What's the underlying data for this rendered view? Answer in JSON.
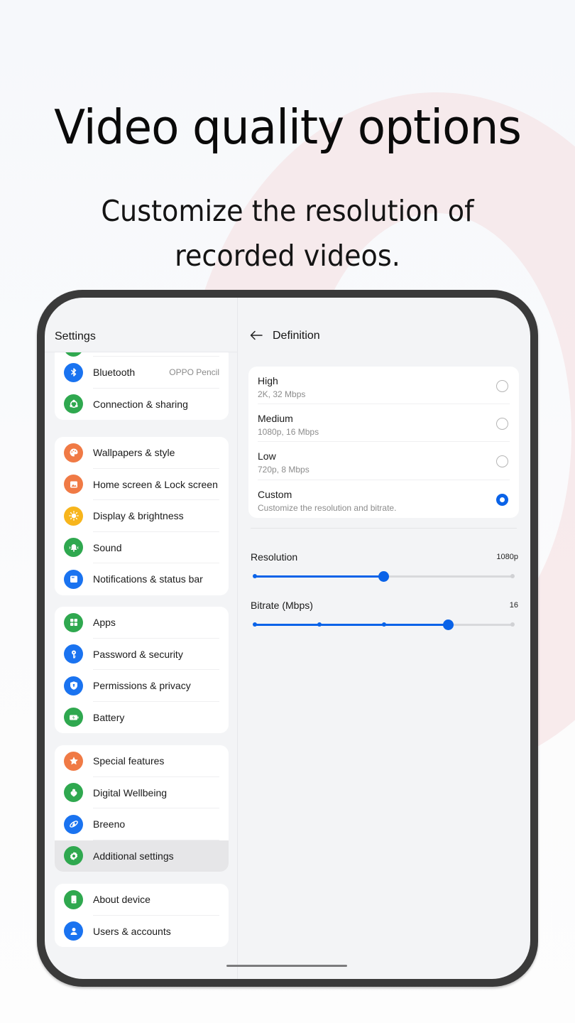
{
  "promo": {
    "headline": "Video quality options",
    "subhead_line1": "Customize the resolution of",
    "subhead_line2": "recorded videos."
  },
  "settings": {
    "title": "Settings",
    "groups": [
      {
        "items": [
          {
            "label": "",
            "icon": "wifi-icon",
            "color": "#2fa84f",
            "partial": true
          },
          {
            "label": "Bluetooth",
            "value": "OPPO Pencil",
            "icon": "bluetooth-icon",
            "color": "#1a73f0"
          },
          {
            "label": "Connection & sharing",
            "icon": "share-icon",
            "color": "#2fa84f"
          }
        ]
      },
      {
        "items": [
          {
            "label": "Wallpapers & style",
            "icon": "palette-icon",
            "color": "#f07a45"
          },
          {
            "label": "Home screen & Lock screen",
            "icon": "image-icon",
            "color": "#f07a45"
          },
          {
            "label": "Display & brightness",
            "icon": "sun-icon",
            "color": "#f7b51c"
          },
          {
            "label": "Sound",
            "icon": "bell-icon",
            "color": "#2fa84f"
          },
          {
            "label": "Notifications & status bar",
            "icon": "notification-icon",
            "color": "#1a73f0"
          }
        ]
      },
      {
        "items": [
          {
            "label": "Apps",
            "icon": "apps-grid-icon",
            "color": "#2fa84f"
          },
          {
            "label": "Password & security",
            "icon": "key-icon",
            "color": "#1a73f0"
          },
          {
            "label": "Permissions & privacy",
            "icon": "shield-icon",
            "color": "#1a73f0"
          },
          {
            "label": "Battery",
            "icon": "battery-icon",
            "color": "#2fa84f"
          }
        ]
      },
      {
        "items": [
          {
            "label": "Special features",
            "icon": "star-icon",
            "color": "#f07a45"
          },
          {
            "label": "Digital Wellbeing",
            "icon": "heart-person-icon",
            "color": "#2fa84f"
          },
          {
            "label": "Breeno",
            "icon": "breeno-icon",
            "color": "#1a73f0"
          },
          {
            "label": "Additional settings",
            "icon": "gear-icon",
            "color": "#2fa84f",
            "active": true
          }
        ]
      },
      {
        "items": [
          {
            "label": "About device",
            "icon": "phone-icon",
            "color": "#2fa84f"
          },
          {
            "label": "Users & accounts",
            "icon": "user-icon",
            "color": "#1a73f0"
          }
        ]
      }
    ]
  },
  "definition": {
    "title": "Definition",
    "options": [
      {
        "title": "High",
        "subtitle": "2K, 32 Mbps",
        "selected": false
      },
      {
        "title": "Medium",
        "subtitle": "1080p, 16 Mbps",
        "selected": false
      },
      {
        "title": "Low",
        "subtitle": "720p, 8 Mbps",
        "selected": false
      },
      {
        "title": "Custom",
        "subtitle": "Customize the resolution and bitrate.",
        "selected": true
      }
    ],
    "resolution": {
      "label": "Resolution",
      "value": "1080p",
      "stops": 3,
      "selected_index": 1
    },
    "bitrate": {
      "label": "Bitrate (Mbps)",
      "value": "16",
      "stops": 5,
      "selected_index": 3
    }
  },
  "colors": {
    "accent": "#0a63e8"
  }
}
